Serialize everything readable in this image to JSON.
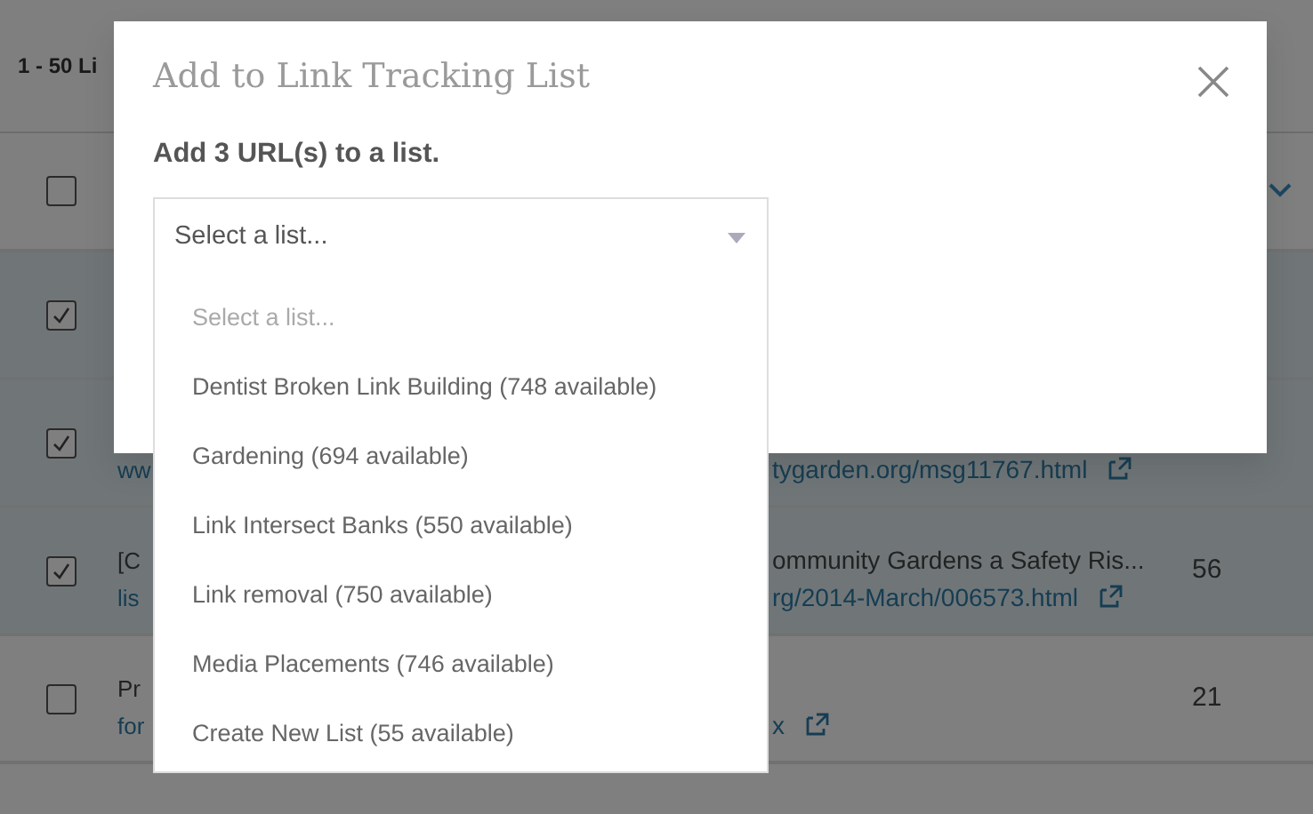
{
  "background": {
    "range_label": "1 - 50 Li",
    "header_checkbox": {
      "checked": false
    },
    "rows": [
      {
        "checked": true
      },
      {
        "checked": true,
        "url_fragment": "ww",
        "url_right": "tygarden.org/msg11767.html"
      },
      {
        "checked": true,
        "title_fragment": "[C",
        "url_fragment": "lis",
        "title_right": "ommunity Gardens a Safety Ris...",
        "url_right": "rg/2014-March/006573.html",
        "count": "56"
      },
      {
        "checked": false,
        "title_fragment": "Pr",
        "url_fragment": "for",
        "url_right": "x",
        "count": "21"
      }
    ]
  },
  "modal": {
    "title": "Add to Link Tracking List",
    "subtitle": "Add 3 URL(s) to a list.",
    "select": {
      "placeholder": "Select a list..."
    },
    "options": [
      {
        "kind": "placeholder",
        "label": "Select a list..."
      },
      {
        "kind": "option",
        "label": "Dentist Broken Link Building (748 available)"
      },
      {
        "kind": "option",
        "label": "Gardening (694 available)"
      },
      {
        "kind": "option",
        "label": "Link Intersect Banks (550 available)"
      },
      {
        "kind": "option",
        "label": "Link removal (750 available)"
      },
      {
        "kind": "option",
        "label": "Media Placements (746 available)"
      },
      {
        "kind": "option",
        "label": "Create New List (55 available)"
      }
    ]
  }
}
